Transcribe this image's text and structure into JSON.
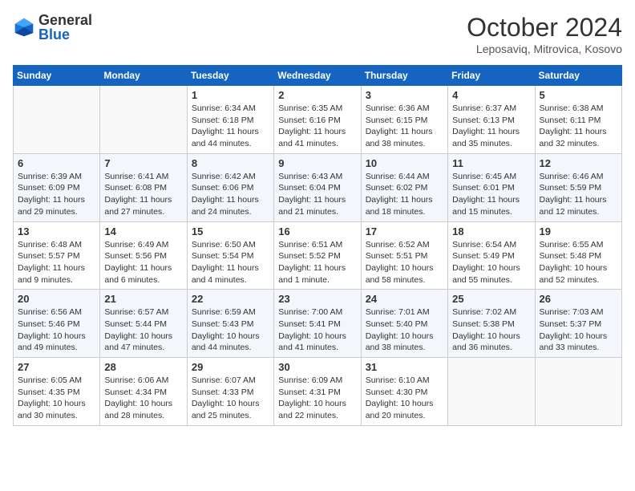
{
  "header": {
    "logo_general": "General",
    "logo_blue": "Blue",
    "month_title": "October 2024",
    "location": "Leposaviq, Mitrovica, Kosovo"
  },
  "days_of_week": [
    "Sunday",
    "Monday",
    "Tuesday",
    "Wednesday",
    "Thursday",
    "Friday",
    "Saturday"
  ],
  "weeks": [
    [
      {
        "day": "",
        "info": ""
      },
      {
        "day": "",
        "info": ""
      },
      {
        "day": "1",
        "info": "Sunrise: 6:34 AM\nSunset: 6:18 PM\nDaylight: 11 hours and 44 minutes."
      },
      {
        "day": "2",
        "info": "Sunrise: 6:35 AM\nSunset: 6:16 PM\nDaylight: 11 hours and 41 minutes."
      },
      {
        "day": "3",
        "info": "Sunrise: 6:36 AM\nSunset: 6:15 PM\nDaylight: 11 hours and 38 minutes."
      },
      {
        "day": "4",
        "info": "Sunrise: 6:37 AM\nSunset: 6:13 PM\nDaylight: 11 hours and 35 minutes."
      },
      {
        "day": "5",
        "info": "Sunrise: 6:38 AM\nSunset: 6:11 PM\nDaylight: 11 hours and 32 minutes."
      }
    ],
    [
      {
        "day": "6",
        "info": "Sunrise: 6:39 AM\nSunset: 6:09 PM\nDaylight: 11 hours and 29 minutes."
      },
      {
        "day": "7",
        "info": "Sunrise: 6:41 AM\nSunset: 6:08 PM\nDaylight: 11 hours and 27 minutes."
      },
      {
        "day": "8",
        "info": "Sunrise: 6:42 AM\nSunset: 6:06 PM\nDaylight: 11 hours and 24 minutes."
      },
      {
        "day": "9",
        "info": "Sunrise: 6:43 AM\nSunset: 6:04 PM\nDaylight: 11 hours and 21 minutes."
      },
      {
        "day": "10",
        "info": "Sunrise: 6:44 AM\nSunset: 6:02 PM\nDaylight: 11 hours and 18 minutes."
      },
      {
        "day": "11",
        "info": "Sunrise: 6:45 AM\nSunset: 6:01 PM\nDaylight: 11 hours and 15 minutes."
      },
      {
        "day": "12",
        "info": "Sunrise: 6:46 AM\nSunset: 5:59 PM\nDaylight: 11 hours and 12 minutes."
      }
    ],
    [
      {
        "day": "13",
        "info": "Sunrise: 6:48 AM\nSunset: 5:57 PM\nDaylight: 11 hours and 9 minutes."
      },
      {
        "day": "14",
        "info": "Sunrise: 6:49 AM\nSunset: 5:56 PM\nDaylight: 11 hours and 6 minutes."
      },
      {
        "day": "15",
        "info": "Sunrise: 6:50 AM\nSunset: 5:54 PM\nDaylight: 11 hours and 4 minutes."
      },
      {
        "day": "16",
        "info": "Sunrise: 6:51 AM\nSunset: 5:52 PM\nDaylight: 11 hours and 1 minute."
      },
      {
        "day": "17",
        "info": "Sunrise: 6:52 AM\nSunset: 5:51 PM\nDaylight: 10 hours and 58 minutes."
      },
      {
        "day": "18",
        "info": "Sunrise: 6:54 AM\nSunset: 5:49 PM\nDaylight: 10 hours and 55 minutes."
      },
      {
        "day": "19",
        "info": "Sunrise: 6:55 AM\nSunset: 5:48 PM\nDaylight: 10 hours and 52 minutes."
      }
    ],
    [
      {
        "day": "20",
        "info": "Sunrise: 6:56 AM\nSunset: 5:46 PM\nDaylight: 10 hours and 49 minutes."
      },
      {
        "day": "21",
        "info": "Sunrise: 6:57 AM\nSunset: 5:44 PM\nDaylight: 10 hours and 47 minutes."
      },
      {
        "day": "22",
        "info": "Sunrise: 6:59 AM\nSunset: 5:43 PM\nDaylight: 10 hours and 44 minutes."
      },
      {
        "day": "23",
        "info": "Sunrise: 7:00 AM\nSunset: 5:41 PM\nDaylight: 10 hours and 41 minutes."
      },
      {
        "day": "24",
        "info": "Sunrise: 7:01 AM\nSunset: 5:40 PM\nDaylight: 10 hours and 38 minutes."
      },
      {
        "day": "25",
        "info": "Sunrise: 7:02 AM\nSunset: 5:38 PM\nDaylight: 10 hours and 36 minutes."
      },
      {
        "day": "26",
        "info": "Sunrise: 7:03 AM\nSunset: 5:37 PM\nDaylight: 10 hours and 33 minutes."
      }
    ],
    [
      {
        "day": "27",
        "info": "Sunrise: 6:05 AM\nSunset: 4:35 PM\nDaylight: 10 hours and 30 minutes."
      },
      {
        "day": "28",
        "info": "Sunrise: 6:06 AM\nSunset: 4:34 PM\nDaylight: 10 hours and 28 minutes."
      },
      {
        "day": "29",
        "info": "Sunrise: 6:07 AM\nSunset: 4:33 PM\nDaylight: 10 hours and 25 minutes."
      },
      {
        "day": "30",
        "info": "Sunrise: 6:09 AM\nSunset: 4:31 PM\nDaylight: 10 hours and 22 minutes."
      },
      {
        "day": "31",
        "info": "Sunrise: 6:10 AM\nSunset: 4:30 PM\nDaylight: 10 hours and 20 minutes."
      },
      {
        "day": "",
        "info": ""
      },
      {
        "day": "",
        "info": ""
      }
    ]
  ]
}
